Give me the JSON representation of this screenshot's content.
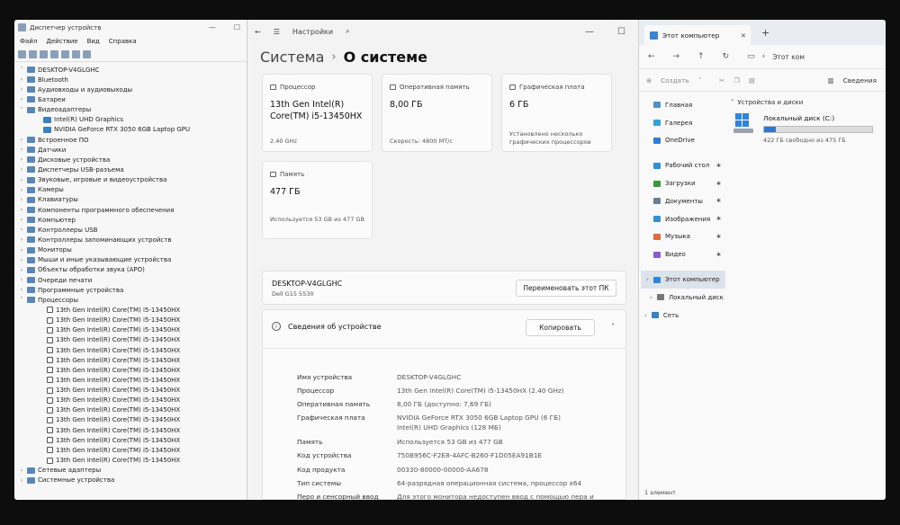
{
  "device_manager": {
    "title": "Диспетчер устройств",
    "menu": [
      "Файл",
      "Действие",
      "Вид",
      "Справка"
    ],
    "root": "DESKTOP-V4GLGHC",
    "tree": [
      {
        "label": "Bluetooth",
        "level": 1,
        "exp": "›"
      },
      {
        "label": "Аудиовходы и аудиовыходы",
        "level": 1,
        "exp": "›"
      },
      {
        "label": "Батареи",
        "level": 1,
        "exp": "›"
      },
      {
        "label": "Видеоадаптеры",
        "level": 1,
        "exp": "˅"
      },
      {
        "label": "Intel(R) UHD Graphics",
        "level": 2,
        "exp": ""
      },
      {
        "label": "NVIDIA GeForce RTX 3050 6GB Laptop GPU",
        "level": 2,
        "exp": ""
      },
      {
        "label": "Встроенное ПО",
        "level": 1,
        "exp": "›"
      },
      {
        "label": "Датчики",
        "level": 1,
        "exp": "›"
      },
      {
        "label": "Дисковые устройства",
        "level": 1,
        "exp": "›"
      },
      {
        "label": "Диспетчеры USB-разъема",
        "level": 1,
        "exp": "›"
      },
      {
        "label": "Звуковые, игровые и видеоустройства",
        "level": 1,
        "exp": "›"
      },
      {
        "label": "Камеры",
        "level": 1,
        "exp": "›"
      },
      {
        "label": "Клавиатуры",
        "level": 1,
        "exp": "›"
      },
      {
        "label": "Компоненты программного обеспечения",
        "level": 1,
        "exp": "›"
      },
      {
        "label": "Компьютер",
        "level": 1,
        "exp": "›"
      },
      {
        "label": "Контроллеры USB",
        "level": 1,
        "exp": "›"
      },
      {
        "label": "Контроллеры запоминающих устройств",
        "level": 1,
        "exp": "›"
      },
      {
        "label": "Мониторы",
        "level": 1,
        "exp": "›"
      },
      {
        "label": "Мыши и иные указывающие устройства",
        "level": 1,
        "exp": "›"
      },
      {
        "label": "Объекты обработки звука (APO)",
        "level": 1,
        "exp": "›"
      },
      {
        "label": "Очереди печати",
        "level": 1,
        "exp": "›"
      },
      {
        "label": "Программные устройства",
        "level": 1,
        "exp": "›"
      },
      {
        "label": "Процессоры",
        "level": 1,
        "exp": "˅"
      },
      {
        "label": "13th Gen Intel(R) Core(TM) i5-13450HX",
        "level": 3,
        "exp": ""
      },
      {
        "label": "13th Gen Intel(R) Core(TM) i5-13450HX",
        "level": 3,
        "exp": ""
      },
      {
        "label": "13th Gen Intel(R) Core(TM) i5-13450HX",
        "level": 3,
        "exp": ""
      },
      {
        "label": "13th Gen Intel(R) Core(TM) i5-13450HX",
        "level": 3,
        "exp": ""
      },
      {
        "label": "13th Gen Intel(R) Core(TM) i5-13450HX",
        "level": 3,
        "exp": ""
      },
      {
        "label": "13th Gen Intel(R) Core(TM) i5-13450HX",
        "level": 3,
        "exp": ""
      },
      {
        "label": "13th Gen Intel(R) Core(TM) i5-13450HX",
        "level": 3,
        "exp": ""
      },
      {
        "label": "13th Gen Intel(R) Core(TM) i5-13450HX",
        "level": 3,
        "exp": ""
      },
      {
        "label": "13th Gen Intel(R) Core(TM) i5-13450HX",
        "level": 3,
        "exp": ""
      },
      {
        "label": "13th Gen Intel(R) Core(TM) i5-13450HX",
        "level": 3,
        "exp": ""
      },
      {
        "label": "13th Gen Intel(R) Core(TM) i5-13450HX",
        "level": 3,
        "exp": ""
      },
      {
        "label": "13th Gen Intel(R) Core(TM) i5-13450HX",
        "level": 3,
        "exp": ""
      },
      {
        "label": "13th Gen Intel(R) Core(TM) i5-13450HX",
        "level": 3,
        "exp": ""
      },
      {
        "label": "13th Gen Intel(R) Core(TM) i5-13450HX",
        "level": 3,
        "exp": ""
      },
      {
        "label": "13th Gen Intel(R) Core(TM) i5-13450HX",
        "level": 3,
        "exp": ""
      },
      {
        "label": "13th Gen Intel(R) Core(TM) i5-13450HX",
        "level": 3,
        "exp": ""
      },
      {
        "label": "Сетевые адаптеры",
        "level": 1,
        "exp": "›"
      },
      {
        "label": "Системные устройства",
        "level": 1,
        "exp": "›"
      }
    ]
  },
  "settings": {
    "app_title": "Настройки",
    "breadcrumb_parent": "Система",
    "breadcrumb_current": "О системе",
    "cards": {
      "cpu": {
        "label": "Процессор",
        "value": "13th Gen Intel(R) Core(TM) i5-13450HX",
        "sub": "2.40 GHz"
      },
      "ram": {
        "label": "Оперативная память",
        "value": "8,00 ГБ",
        "sub": "Скорость: 4800 МТ/с"
      },
      "gpu": {
        "label": "Графическая плата",
        "value": "6 ГБ",
        "sub": "Установлено несколько графических процессоров"
      },
      "storage": {
        "label": "Память",
        "value": "477 ГБ",
        "sub": "Используется 53 GB из 477 GB"
      }
    },
    "pc_name": "DESKTOP-V4GLGHC",
    "pc_model": "Dell G15 5530",
    "rename_button": "Переименовать этот ПК",
    "device_info_title": "Сведения об устройстве",
    "copy_button": "Копировать",
    "specs": [
      {
        "key": "Имя устройства",
        "value": "DESKTOP-V4GLGHC"
      },
      {
        "key": "Процессор",
        "value": "13th Gen Intel(R) Core(TM) i5-13450HX (2.40 GHz)"
      },
      {
        "key": "Оперативная память",
        "value": "8,00 ГБ (доступно: 7,69 ГБ)"
      },
      {
        "key": "Графическая плата",
        "value": "NVIDIA GeForce RTX 3050 6GB Laptop GPU (6 ГБ)"
      },
      {
        "key": "",
        "value": "Intel(R) UHD Graphics (128 МБ)"
      },
      {
        "key": "Память",
        "value": "Используется 53 GB из 477 GB"
      },
      {
        "key": "Код устройства",
        "value": "750B956C-F2E8-4AFC-B260-F1D05EA91B1E"
      },
      {
        "key": "Код продукта",
        "value": "00330-80000-00000-AA678"
      },
      {
        "key": "Тип системы",
        "value": "64-разрядная операционная система, процессор x64"
      },
      {
        "key": "Перо и сенсорный ввод",
        "value": "Для этого монитора недоступен ввод с помощью пера и сенсорный ввод"
      }
    ]
  },
  "explorer": {
    "tab_title": "Этот компьютер",
    "address": "Этот ком",
    "create_label": "Создать",
    "details_label": "Сведения",
    "nav": [
      {
        "label": "Главная",
        "pin": false
      },
      {
        "label": "Галерея",
        "pin": false
      },
      {
        "label": "OneDrive",
        "pin": false
      },
      {
        "label": "Рабочий стол",
        "pin": true
      },
      {
        "label": "Загрузки",
        "pin": true
      },
      {
        "label": "Документы",
        "pin": true
      },
      {
        "label": "Изображения",
        "pin": true
      },
      {
        "label": "Музыка",
        "pin": true
      },
      {
        "label": "Видео",
        "pin": true
      },
      {
        "label": "Этот компьютер",
        "pin": false
      },
      {
        "label": "Локальный диск",
        "pin": false
      },
      {
        "label": "Сеть",
        "pin": false
      }
    ],
    "section_title": "Устройства и диски",
    "drive_name": "Локальный диск (C:)",
    "drive_free": "422 ГБ свободно из 475 ГБ",
    "drive_used_fraction": 0.11,
    "status": "1 элемент",
    "accent": "#2a7ad4"
  }
}
